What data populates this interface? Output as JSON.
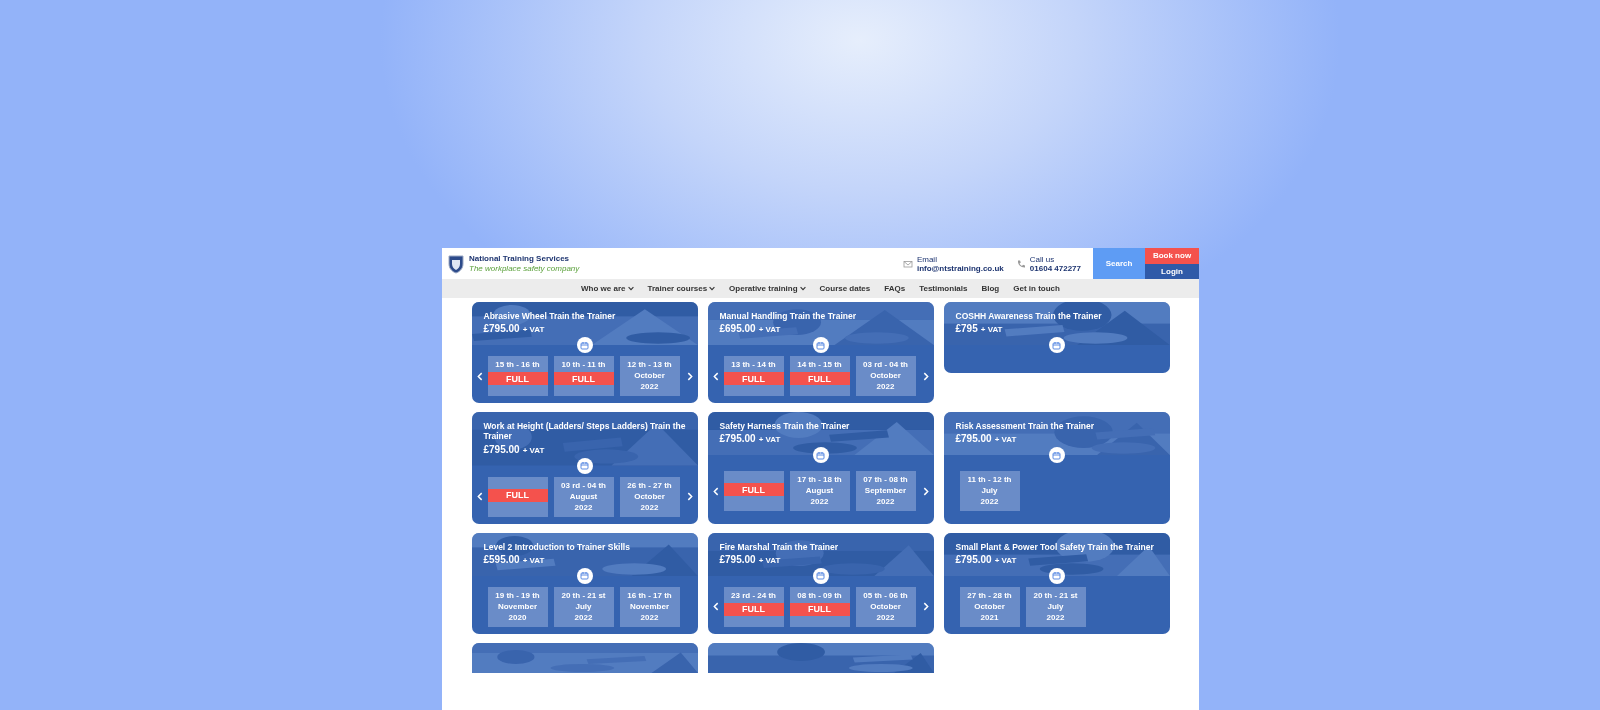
{
  "header": {
    "company": "National Training Services",
    "tagline": "The workplace safety company",
    "email_label": "Email",
    "email": "info@ntstraining.co.uk",
    "phone_label": "Call us",
    "phone": "01604 472277",
    "search": "Search",
    "book": "Book now",
    "login": "Login"
  },
  "nav": [
    {
      "label": "Who we are",
      "has_menu": true
    },
    {
      "label": "Trainer courses",
      "has_menu": true
    },
    {
      "label": "Operative training",
      "has_menu": true
    },
    {
      "label": "Course dates",
      "has_menu": false
    },
    {
      "label": "FAQs",
      "has_menu": false
    },
    {
      "label": "Testimonials",
      "has_menu": false
    },
    {
      "label": "Blog",
      "has_menu": false
    },
    {
      "label": "Get in touch",
      "has_menu": false
    }
  ],
  "courses": [
    {
      "title": "Abrasive Wheel Train the Trainer",
      "price": "£795.00",
      "vat": "+ VAT",
      "arrows": true,
      "dates": [
        {
          "dates": "15 th - 16 th",
          "full": true,
          "full_label": "FULL"
        },
        {
          "dates": "10 th - 11 th",
          "full": true,
          "full_label": "FULL"
        },
        {
          "dates": "12 th - 13 th",
          "month": "October",
          "year": "2022",
          "full": false
        }
      ]
    },
    {
      "title": "Manual Handling Train the Trainer",
      "price": "£695.00",
      "vat": "+ VAT",
      "arrows": true,
      "dates": [
        {
          "dates": "13 th - 14 th",
          "full": true,
          "full_label": "FULL"
        },
        {
          "dates": "14 th - 15 th",
          "full": true,
          "full_label": "FULL"
        },
        {
          "dates": "03 rd - 04 th",
          "month": "October",
          "year": "2022",
          "full": false
        }
      ]
    },
    {
      "title": "COSHH Awareness Train the Trainer",
      "price": "£795",
      "vat": "+ VAT",
      "arrows": false
    },
    {
      "title": "Work at Height (Ladders/ Steps Ladders) Train the Trainer",
      "price": "£795.00",
      "vat": "+ VAT",
      "arrows": true,
      "dates": [
        {
          "full": true,
          "full_label": "FULL"
        },
        {
          "dates": "03 rd - 04 th",
          "month": "August",
          "year": "2022",
          "full": false
        },
        {
          "dates": "26 th - 27 th",
          "month": "October",
          "year": "2022",
          "full": false
        }
      ]
    },
    {
      "title": "Safety Harness Train the Trainer",
      "price": "£795.00",
      "vat": "+ VAT",
      "arrows": true,
      "dates": [
        {
          "full": true,
          "full_label": "FULL"
        },
        {
          "dates": "17 th - 18 th",
          "month": "August",
          "year": "2022",
          "full": false
        },
        {
          "dates": "07 th - 08 th",
          "month": "September",
          "year": "2022",
          "full": false
        }
      ]
    },
    {
      "title": "Risk Assessment Train the Trainer",
      "price": "£795.00",
      "vat": "+ VAT",
      "arrows": false,
      "dates": [
        {
          "dates": "11 th - 12 th",
          "month": "July",
          "year": "2022",
          "full": false
        }
      ]
    },
    {
      "title": "Level 2 Introduction to Trainer Skills",
      "price": "£595.00",
      "vat": "+ VAT",
      "arrows": false,
      "dates": [
        {
          "dates": "19 th - 19 th",
          "month": "November",
          "year": "2020",
          "full": false
        },
        {
          "dates": "20 th - 21 st",
          "month": "July",
          "year": "2022",
          "full": false
        },
        {
          "dates": "16 th - 17 th",
          "month": "November",
          "year": "2022",
          "full": false
        }
      ]
    },
    {
      "title": "Fire Marshal Train the Trainer",
      "price": "£795.00",
      "vat": "+ VAT",
      "arrows": true,
      "dates": [
        {
          "dates": "23 rd - 24 th",
          "full": true,
          "full_label": "FULL"
        },
        {
          "dates": "08 th - 09 th",
          "full": true,
          "full_label": "FULL"
        },
        {
          "dates": "05 th - 06 th",
          "month": "October",
          "year": "2022",
          "full": false
        }
      ]
    },
    {
      "title": "Small Plant & Power Tool Safety Train the Trainer",
      "price": "£795.00",
      "vat": "+ VAT",
      "arrows": false,
      "dates": [
        {
          "dates": "27 th - 28 th",
          "month": "October",
          "year": "2021",
          "full": false
        },
        {
          "dates": "20 th - 21 st",
          "month": "July",
          "year": "2022",
          "full": false
        }
      ]
    }
  ]
}
